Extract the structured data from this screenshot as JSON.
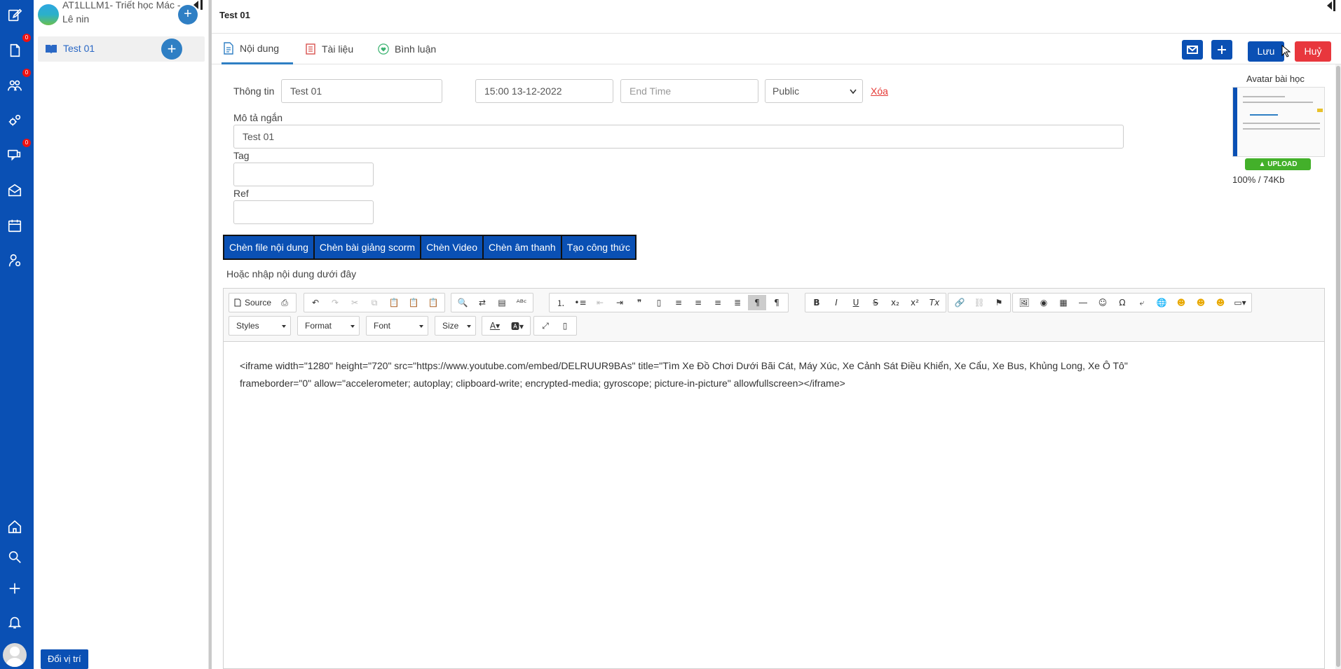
{
  "rail": {
    "badges": [
      "0",
      "0",
      "0"
    ]
  },
  "course": {
    "title": "AT1LLLM1- Triết học Mác - Lê nin",
    "add_label": "+",
    "lesson_label": "Test 01",
    "lesson_add_label": "+",
    "swap_label": "Đổi vị trí"
  },
  "header": {
    "title": "Test 01"
  },
  "tabs": [
    {
      "label": "Nội dung"
    },
    {
      "label": "Tài liệu"
    },
    {
      "label": "Bình luận"
    }
  ],
  "actions": {
    "save_label": "Lưu",
    "cancel_label": "Huỷ"
  },
  "form": {
    "info_label": "Thông tin",
    "title_value": "Test 01",
    "start_time_value": "15:00 13-12-2022",
    "end_time_placeholder": "End Time",
    "visibility_value": "Public",
    "delete_label": "Xóa",
    "short_desc_label": "Mô tả ngắn",
    "short_desc_value": "Test 01",
    "tag_label": "Tag",
    "ref_label": "Ref"
  },
  "avatar": {
    "title": "Avatar bài học",
    "upload_label": "UPLOAD",
    "upload_status": "100% / 74Kb"
  },
  "insert_buttons": [
    {
      "label": "Chèn file nội dung"
    },
    {
      "label": "Chèn bài giảng scorm"
    },
    {
      "label": "Chèn Video"
    },
    {
      "label": "Chèn âm thanh"
    },
    {
      "label": "Tạo công thức"
    }
  ],
  "hint": "Hoặc nhập nội dung dưới đây",
  "editor": {
    "source_label": "Source",
    "combos": [
      "Styles",
      "Format",
      "Font",
      "Size"
    ],
    "content": "<iframe width=\"1280\" height=\"720\" src=\"https://www.youtube.com/embed/DELRUUR9BAs\" title=\"Tìm Xe Đồ Chơi Dưới Bãi Cát, Máy Xúc, Xe Cảnh Sát Điều Khiển, Xe Cẩu, Xe Bus, Khủng Long, Xe Ô Tô\"\nframeborder=\"0\" allow=\"accelerometer; autoplay; clipboard-write; encrypted-media; gyroscope; picture-in-picture\" allowfullscreen></iframe>"
  },
  "colors": {
    "rail": "#0a50b4",
    "accent": "#2f7fc4",
    "danger": "#e8373d",
    "upload": "#43b02a"
  }
}
